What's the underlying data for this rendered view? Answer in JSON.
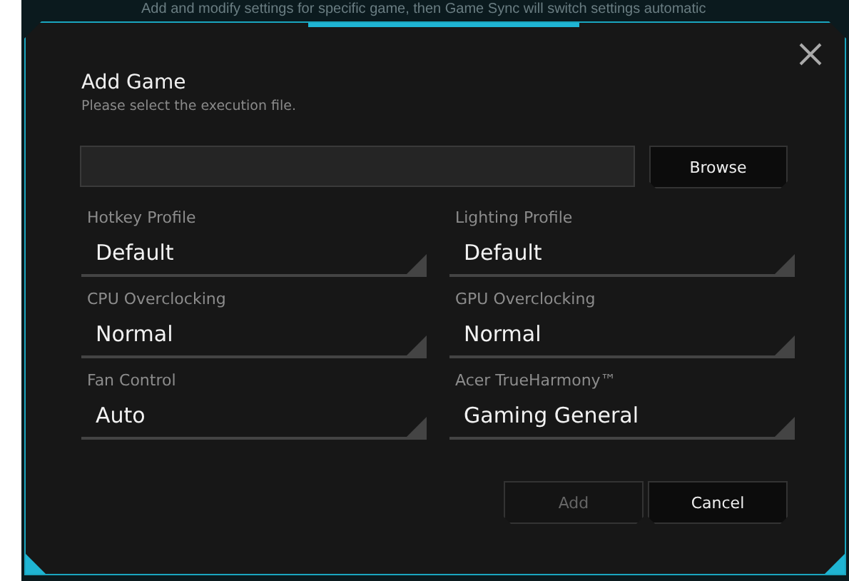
{
  "background_text": "Add and modify settings for specific game, then Game Sync will switch settings automatic",
  "dialog": {
    "title": "Add Game",
    "subtitle": "Please select the execution file.",
    "browse_button": "Browse",
    "fields": [
      {
        "label": "Hotkey Profile",
        "value": "Default"
      },
      {
        "label": "Lighting Profile",
        "value": "Default"
      },
      {
        "label": "CPU Overclocking",
        "value": "Normal"
      },
      {
        "label": "GPU Overclocking",
        "value": "Normal"
      },
      {
        "label": "Fan Control",
        "value": "Auto"
      },
      {
        "label": "Acer TrueHarmony™",
        "value": "Gaming General"
      }
    ],
    "buttons": [
      {
        "label": "Add",
        "disabled": true
      },
      {
        "label": "Cancel",
        "disabled": false
      }
    ]
  }
}
